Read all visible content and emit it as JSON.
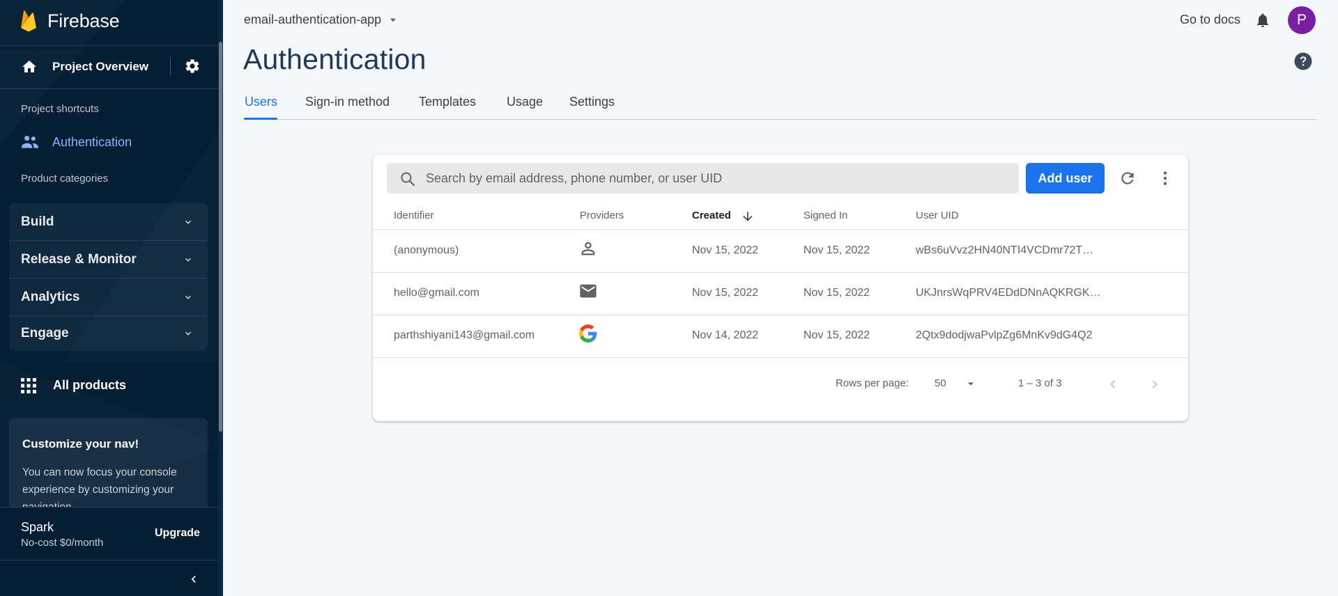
{
  "sidebar": {
    "brand": "Firebase",
    "project_overview": "Project Overview",
    "shortcuts_heading": "Project shortcuts",
    "shortcut_auth": "Authentication",
    "categories_heading": "Product categories",
    "categories": [
      {
        "label": "Build"
      },
      {
        "label": "Release & Monitor"
      },
      {
        "label": "Analytics"
      },
      {
        "label": "Engage"
      }
    ],
    "all_products": "All products",
    "promo": {
      "title": "Customize your nav!",
      "body": "You can now focus your console experience by customizing your navigation"
    },
    "plan": {
      "name": "Spark",
      "price": "No-cost $0/month",
      "upgrade": "Upgrade"
    }
  },
  "header": {
    "project": "email-authentication-app",
    "docs": "Go to docs",
    "avatar_letter": "P"
  },
  "page": {
    "title": "Authentication",
    "tabs": [
      {
        "label": "Users"
      },
      {
        "label": "Sign-in method"
      },
      {
        "label": "Templates"
      },
      {
        "label": "Usage"
      },
      {
        "label": "Settings"
      }
    ]
  },
  "users": {
    "search_placeholder": "Search by email address, phone number, or user UID",
    "add_user": "Add user",
    "columns": {
      "identifier": "Identifier",
      "providers": "Providers",
      "created": "Created",
      "signed_in": "Signed In",
      "uid": "User UID"
    },
    "rows": [
      {
        "identifier": "(anonymous)",
        "provider": "anonymous-icon",
        "created": "Nov 15, 2022",
        "signed_in": "Nov 15, 2022",
        "uid": "wBs6uVvz2HN40NTI4VCDmr72T…"
      },
      {
        "identifier": "hello@gmail.com",
        "provider": "email-icon",
        "created": "Nov 15, 2022",
        "signed_in": "Nov 15, 2022",
        "uid": "UKJnrsWqPRV4EDdDNnAQKRGKd…"
      },
      {
        "identifier": "parthshiyani143@gmail.com",
        "provider": "google-icon",
        "created": "Nov 14, 2022",
        "signed_in": "Nov 15, 2022",
        "uid": "2Qtx9dodjwaPvlpZg6MnKv9dG4Q2"
      }
    ],
    "pagination": {
      "rows_label": "Rows per page:",
      "rows_value": "50",
      "range": "1 – 3 of 3"
    }
  },
  "colors": {
    "sidebar_bg": "#051e34",
    "accent": "#1a73e8",
    "avatar": "#7b1fa2",
    "title": "#1f3a56"
  }
}
